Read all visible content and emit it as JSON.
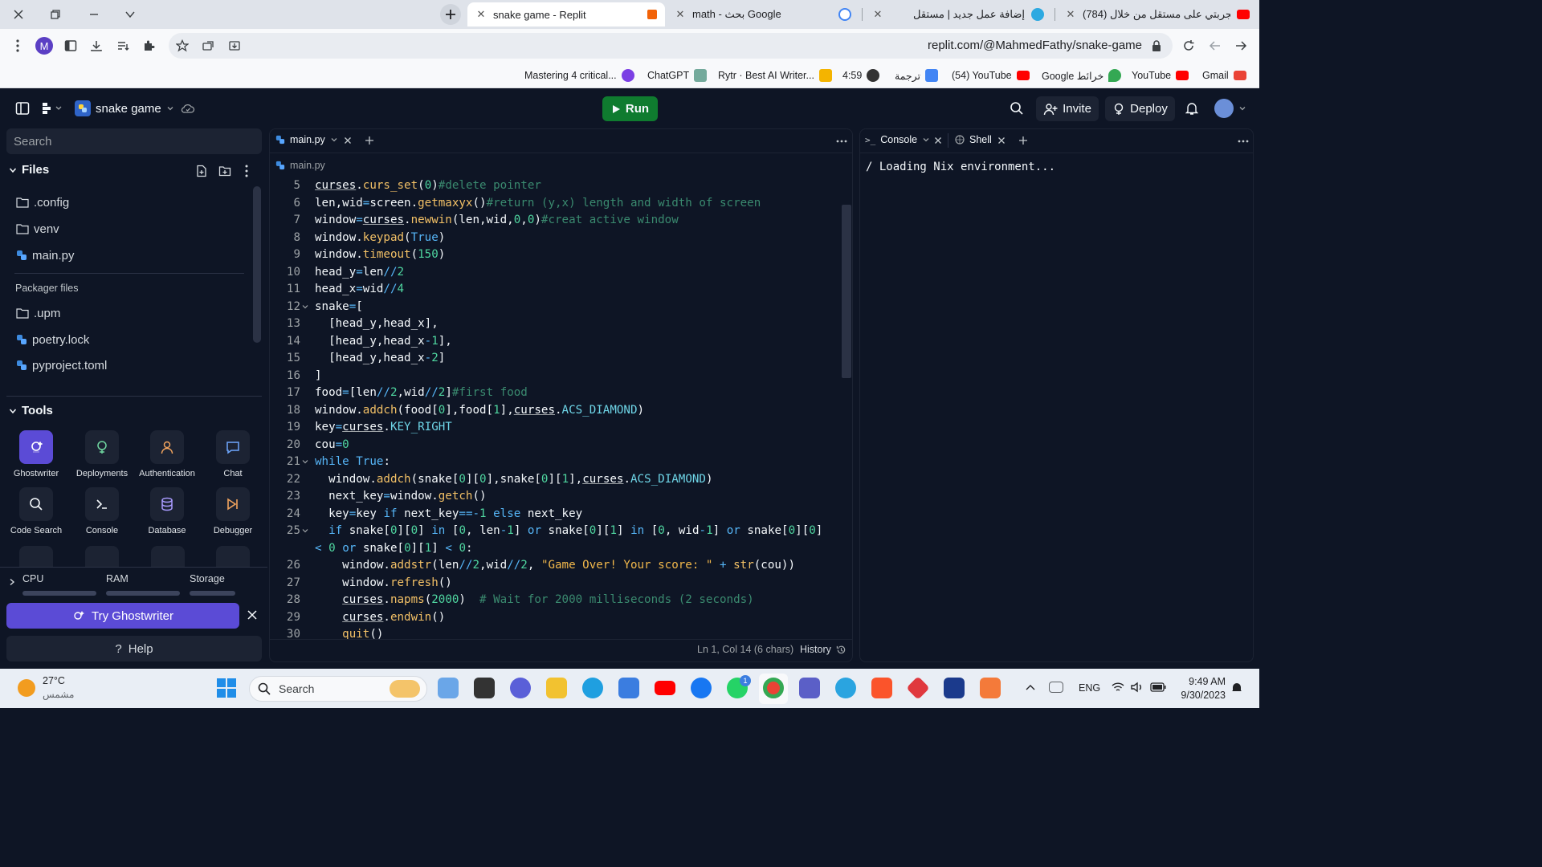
{
  "browser": {
    "tabs": [
      {
        "title": "snake game - Replit",
        "color": "#f26207"
      },
      {
        "title": "math - بحث Google",
        "color": "#4285f4"
      },
      {
        "title": "إضافة عمل جديد | مستقل",
        "color": "#2ca9e1"
      },
      {
        "title": "(784) تجربتي على مستقل من خلال",
        "color": "#ff0000"
      }
    ],
    "profile_initial": "M",
    "url": "replit.com/@MahmedFathy/snake-game",
    "bookmarks": [
      {
        "label": "Mastering 4 critical...",
        "color": "#7b3fe4"
      },
      {
        "label": "ChatGPT",
        "color": "#74aa9c"
      },
      {
        "label": "Rytr · Best AI Writer...",
        "color": "#f4b400"
      },
      {
        "label": "4:59",
        "color": "#333333"
      },
      {
        "label": "ترجمة",
        "color": "#4285f4"
      },
      {
        "label": "(54) YouTube",
        "color": "#ff0000"
      },
      {
        "label": "Google خرائط",
        "color": "#34a853"
      },
      {
        "label": "YouTube",
        "color": "#ff0000"
      },
      {
        "label": "Gmail",
        "color": "#ea4335"
      }
    ]
  },
  "header": {
    "repl_name": "snake game",
    "run_label": "Run",
    "invite_label": "Invite",
    "deploy_label": "Deploy"
  },
  "sidebar": {
    "search_placeholder": "Search",
    "files_title": "Files",
    "files": [
      {
        "name": ".config",
        "kind": "folder"
      },
      {
        "name": "venv",
        "kind": "folder"
      },
      {
        "name": "main.py",
        "kind": "python"
      }
    ],
    "packager_title": "Packager files",
    "packager_files": [
      {
        "name": ".upm",
        "kind": "folder"
      },
      {
        "name": "poetry.lock",
        "kind": "python"
      },
      {
        "name": "pyproject.toml",
        "kind": "python"
      }
    ],
    "tools_title": "Tools",
    "tools": [
      {
        "label": "Ghostwriter",
        "icon": "ghostwriter-icon"
      },
      {
        "label": "Deployments",
        "icon": "deployments-icon"
      },
      {
        "label": "Authentication",
        "icon": "user-icon"
      },
      {
        "label": "Chat",
        "icon": "chat-icon"
      },
      {
        "label": "Code Search",
        "icon": "search-icon"
      },
      {
        "label": "Console",
        "icon": "terminal-icon"
      },
      {
        "label": "Database",
        "icon": "database-icon"
      },
      {
        "label": "Debugger",
        "icon": "debugger-icon"
      }
    ],
    "resources": {
      "cpu": "CPU",
      "ram": "RAM",
      "storage": "Storage"
    },
    "ghostwriter_button": "Try Ghostwriter",
    "help_label": "Help"
  },
  "editor": {
    "tab_label": "main.py",
    "breadcrumb": "main.py",
    "lines": [
      {
        "n": "5",
        "text": "curses.curs_set(0)#delete pointer"
      },
      {
        "n": "6",
        "text": "len,wid=screen.getmaxyx()#return (y,x) length and width of screen"
      },
      {
        "n": "7",
        "text": "window=curses.newwin(len,wid,0,0)#creat active window"
      },
      {
        "n": "8",
        "text": "window.keypad(True)"
      },
      {
        "n": "9",
        "text": "window.timeout(150)"
      },
      {
        "n": "10",
        "text": "head_y=len//2"
      },
      {
        "n": "11",
        "text": "head_x=wid//4"
      },
      {
        "n": "12",
        "text": "snake=["
      },
      {
        "n": "13",
        "text": "  [head_y,head_x],"
      },
      {
        "n": "14",
        "text": "  [head_y,head_x-1],"
      },
      {
        "n": "15",
        "text": "  [head_y,head_x-2]"
      },
      {
        "n": "16",
        "text": "]"
      },
      {
        "n": "17",
        "text": "food=[len//2,wid//2]#first food"
      },
      {
        "n": "18",
        "text": "window.addch(food[0],food[1],curses.ACS_DIAMOND)"
      },
      {
        "n": "19",
        "text": "key=curses.KEY_RIGHT"
      },
      {
        "n": "20",
        "text": "cou=0"
      },
      {
        "n": "21",
        "text": "while True:"
      },
      {
        "n": "22",
        "text": "  window.addch(snake[0][0],snake[0][1],curses.ACS_DIAMOND)"
      },
      {
        "n": "23",
        "text": "  next_key=window.getch()"
      },
      {
        "n": "24",
        "text": "  key=key if next_key==-1 else next_key"
      },
      {
        "n": "25",
        "text": "  if snake[0][0] in [0, len-1] or snake[0][1] in [0, wid-1] or snake[0][0]"
      },
      {
        "n": "",
        "text": "< 0 or snake[0][1] < 0:"
      },
      {
        "n": "26",
        "text": "    window.addstr(len//2,wid//2, \"Game Over! Your score: \" + str(cou))"
      },
      {
        "n": "27",
        "text": "    window.refresh()"
      },
      {
        "n": "28",
        "text": "    curses.napms(2000)  # Wait for 2000 milliseconds (2 seconds)"
      },
      {
        "n": "29",
        "text": "    curses.endwin()"
      },
      {
        "n": "30",
        "text": "    quit()"
      }
    ],
    "status": "Ln 1, Col 14 (6 chars)",
    "history_label": "History"
  },
  "console": {
    "tab_console": "Console",
    "tab_shell": "Shell",
    "output": "/ Loading Nix environment..."
  },
  "taskbar": {
    "temperature": "27°C",
    "weather": "مشمس",
    "search_label": "Search",
    "language": "ENG",
    "time": "9:49 AM",
    "date": "9/30/2023"
  },
  "colors": {
    "bg": "#0e1525",
    "panel": "#1c2333",
    "run": "#0f7b2f",
    "accent": "#5b4bd6",
    "keyword": "#56b6f8",
    "string": "#f2b84b",
    "comment": "#3a8a6f",
    "number": "#4fd6a0"
  }
}
